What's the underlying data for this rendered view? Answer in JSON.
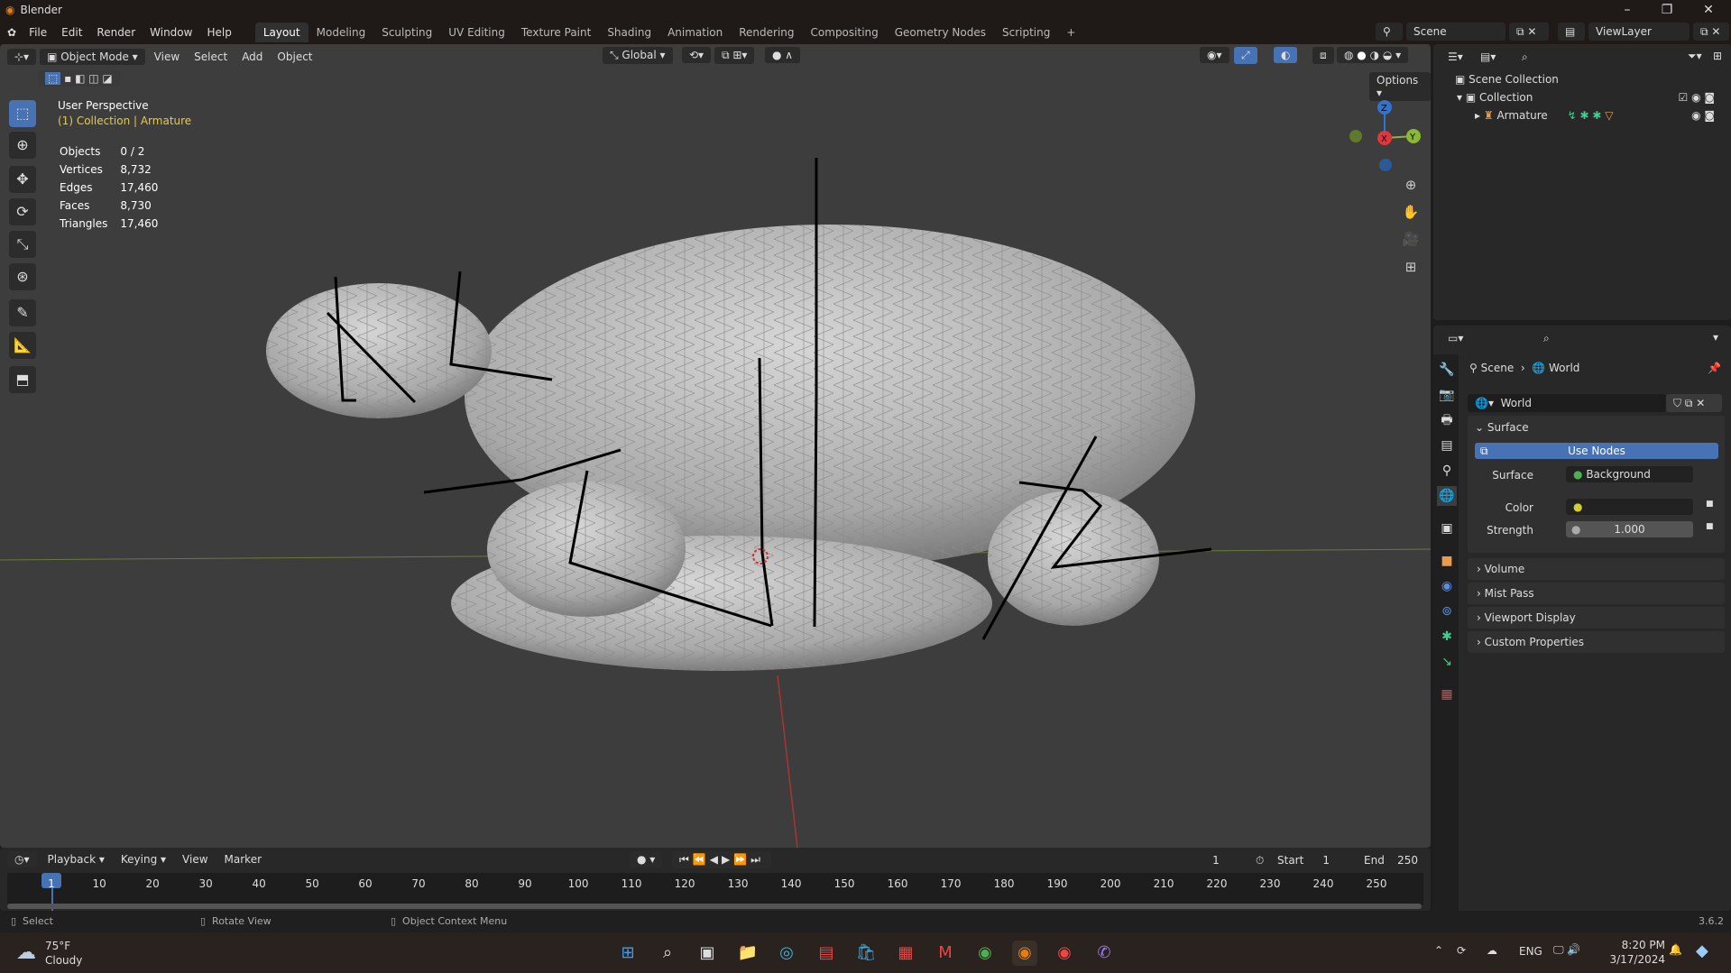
{
  "window": {
    "title": "Blender"
  },
  "menu": [
    "File",
    "Edit",
    "Render",
    "Window",
    "Help"
  ],
  "workspaces": [
    "Layout",
    "Modeling",
    "Sculpting",
    "UV Editing",
    "Texture Paint",
    "Shading",
    "Animation",
    "Rendering",
    "Compositing",
    "Geometry Nodes",
    "Scripting",
    "+"
  ],
  "scene": {
    "name": "Scene",
    "view_layer": "ViewLayer"
  },
  "viewport": {
    "mode": "Object Mode",
    "menus": [
      "View",
      "Select",
      "Add",
      "Object"
    ],
    "orientation": "Global",
    "options": "Options",
    "perspective": "User Perspective",
    "context": "(1) Collection | Armature",
    "stats": [
      {
        "k": "Objects",
        "v": "0 / 2"
      },
      {
        "k": "Vertices",
        "v": "8,732"
      },
      {
        "k": "Edges",
        "v": "17,460"
      },
      {
        "k": "Faces",
        "v": "8,730"
      },
      {
        "k": "Triangles",
        "v": "17,460"
      }
    ],
    "gizmo": {
      "z": "Z",
      "x": "X",
      "y": "Y"
    }
  },
  "outliner": {
    "root": "Scene Collection",
    "collection": "Collection",
    "object": "Armature"
  },
  "properties": {
    "breadcrumb": [
      "Scene",
      "World"
    ],
    "world_name": "World",
    "surface_header": "Surface",
    "use_nodes": "Use Nodes",
    "surface_label": "Surface",
    "surface_value": "Background",
    "color_label": "Color",
    "strength_label": "Strength",
    "strength_value": "1.000",
    "panels": [
      "Volume",
      "Mist Pass",
      "Viewport Display",
      "Custom Properties"
    ]
  },
  "timeline": {
    "menus": [
      "Playback",
      "Keying",
      "View",
      "Marker"
    ],
    "current_frame": "1",
    "start_label": "Start",
    "start": "1",
    "end_label": "End",
    "end": "250",
    "ticks": [
      "1",
      "10",
      "20",
      "30",
      "40",
      "50",
      "60",
      "70",
      "80",
      "90",
      "100",
      "110",
      "120",
      "130",
      "140",
      "150",
      "160",
      "170",
      "180",
      "190",
      "200",
      "210",
      "220",
      "230",
      "240",
      "250"
    ]
  },
  "status": {
    "select": "Select",
    "rotate": "Rotate View",
    "context_menu": "Object Context Menu",
    "version": "3.6.2"
  },
  "taskbar": {
    "temp": "75°F",
    "weather": "Cloudy",
    "lang": "ENG",
    "time": "8:20 PM",
    "date": "3/17/2024"
  }
}
